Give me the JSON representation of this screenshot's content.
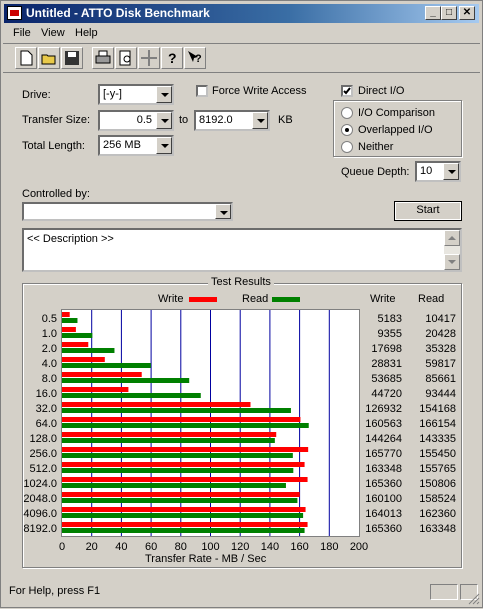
{
  "window": {
    "title": "Untitled - ATTO Disk Benchmark"
  },
  "menu": [
    "File",
    "View",
    "Help"
  ],
  "toolbar": [
    "new-icon",
    "open-icon",
    "save-icon",
    "print-icon",
    "print-preview-icon",
    "move-icon",
    "help-icon",
    "context-help-icon"
  ],
  "form": {
    "drive_label": "Drive:",
    "drive_value": "[-y-]",
    "transfer_size_label": "Transfer Size:",
    "transfer_from": "0.5",
    "to_label": "to",
    "transfer_to": "8192.0",
    "kb_label": "KB",
    "total_length_label": "Total Length:",
    "total_length_value": "256 MB",
    "force_write_label": "Force Write Access",
    "direct_io_label": "Direct I/O",
    "io_comparison_label": "I/O Comparison",
    "overlapped_io_label": "Overlapped I/O",
    "neither_label": "Neither",
    "queue_depth_label": "Queue Depth:",
    "queue_depth_value": "10",
    "controlled_by_label": "Controlled by:",
    "controlled_by_value": "",
    "start_label": "Start",
    "description_text": "<< Description >>"
  },
  "results": {
    "group_label": "Test Results",
    "write_legend": "Write",
    "read_legend": "Read",
    "write_header": "Write",
    "read_header": "Read"
  },
  "status": {
    "text": "For Help, press F1"
  },
  "chart_data": {
    "type": "bar",
    "orientation": "horizontal",
    "xlabel": "Transfer Rate - MB / Sec",
    "xlim": [
      0,
      200
    ],
    "xticks": [
      0,
      20,
      40,
      60,
      80,
      100,
      120,
      140,
      160,
      180,
      200
    ],
    "categories": [
      "0.5",
      "1.0",
      "2.0",
      "4.0",
      "8.0",
      "16.0",
      "32.0",
      "64.0",
      "128.0",
      "256.0",
      "512.0",
      "1024.0",
      "2048.0",
      "4096.0",
      "8192.0"
    ],
    "series": [
      {
        "name": "Write",
        "color": "#ff0000",
        "values": [
          5.183,
          9.355,
          17.698,
          28.831,
          53.685,
          44.72,
          126.932,
          160.563,
          144.264,
          165.77,
          163.348,
          165.36,
          160.1,
          164.013,
          165.36
        ]
      },
      {
        "name": "Read",
        "color": "#008000",
        "values": [
          10.417,
          20.428,
          35.328,
          59.817,
          85.661,
          93.444,
          154.168,
          166.154,
          143.335,
          155.45,
          155.765,
          150.806,
          158.524,
          162.36,
          163.348
        ]
      }
    ],
    "write_text": [
      "5183",
      "9355",
      "17698",
      "28831",
      "53685",
      "44720",
      "126932",
      "160563",
      "144264",
      "165770",
      "163348",
      "165360",
      "160100",
      "164013",
      "165360"
    ],
    "read_text": [
      "10417",
      "20428",
      "35328",
      "59817",
      "85661",
      "93444",
      "154168",
      "166154",
      "143335",
      "155450",
      "155765",
      "150806",
      "158524",
      "162360",
      "163348"
    ]
  }
}
